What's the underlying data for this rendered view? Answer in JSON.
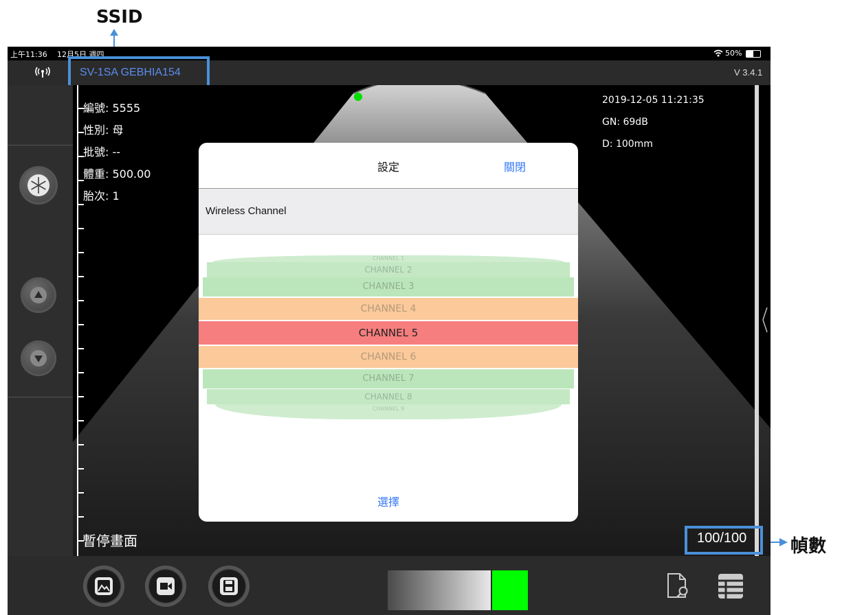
{
  "annotations": {
    "ssid_label": "SSID",
    "frames_label": "幀數"
  },
  "status_bar": {
    "time": "上午11:36",
    "date": "12月5日 週四",
    "battery": "50%"
  },
  "top_bar": {
    "ssid": "SV-1SA GEBHIA154",
    "version": "V 3.4.1"
  },
  "patient_info": {
    "id": "編號: 5555",
    "sex": "性別: 母",
    "batch": "批號: --",
    "weight": "體重: 500.00",
    "parity": "胎次: 1"
  },
  "scan_info": {
    "datetime": "2019-12-05 11:21:35",
    "gain": "GN: 69dB",
    "depth": "D: 100mm"
  },
  "paused_label": "暫停畫面",
  "frame_counter": "100/100",
  "dialog": {
    "title": "設定",
    "close_label": "關閉",
    "section_label": "Wireless Channel",
    "select_label": "選擇",
    "selected_channel": "CHANNEL 5",
    "channels": [
      "CHANNEL 1",
      "CHANNEL 2",
      "CHANNEL 3",
      "CHANNEL 4",
      "CHANNEL 5",
      "CHANNEL 6",
      "CHANNEL 7",
      "CHANNEL 8",
      "CHANNEL 9"
    ]
  },
  "colors": {
    "accent": "#3478f6",
    "channel_green": "#b8e6b8",
    "channel_orange": "#fbc99a",
    "channel_red": "#f77e7e",
    "annotation_blue": "#4a90d9",
    "status_green": "#00ff00"
  },
  "icons": [
    "wifi-antenna-icon",
    "freeze-icon",
    "arrow-up-icon",
    "arrow-down-icon",
    "gallery-icon",
    "video-icon",
    "save-icon",
    "file-search-icon",
    "table-list-icon",
    "chevron-left-icon"
  ]
}
